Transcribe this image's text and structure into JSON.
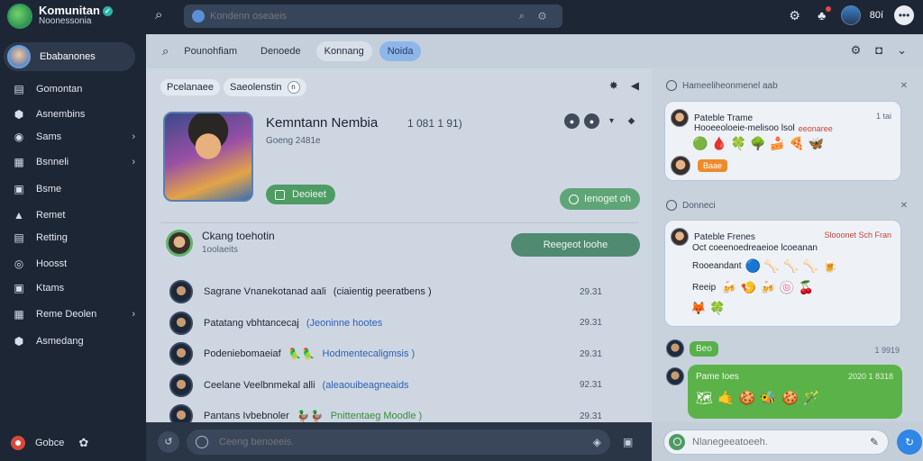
{
  "app": {
    "title": "Komunitan",
    "subtitle": "Noonessonia"
  },
  "top": {
    "search_placeholder": "Kondenn oseaeis",
    "search_tools": "⌕ ⚙",
    "count": "80í",
    "icons": [
      "gear-icon",
      "bell-icon",
      "avatar",
      "more-icon"
    ]
  },
  "sidebar": {
    "profile_name": "Ebabanones",
    "items": [
      {
        "label": "Gomontan",
        "icon": "▤",
        "chevron": ""
      },
      {
        "label": "Asnembins",
        "icon": "⬢",
        "chevron": ""
      },
      {
        "label": "Sams",
        "icon": "◉",
        "chevron": "›"
      },
      {
        "label": "Bsnneli",
        "icon": "▦",
        "chevron": "›"
      },
      {
        "label": "Bsme",
        "icon": "▣",
        "chevron": ""
      },
      {
        "label": "Remet",
        "icon": "▲",
        "chevron": ""
      },
      {
        "label": "Retting",
        "icon": "▤",
        "chevron": ""
      },
      {
        "label": "Hoosst",
        "icon": "◎",
        "chevron": ""
      },
      {
        "label": "Ktams",
        "icon": "▣",
        "chevron": ""
      },
      {
        "label": "Reme Deolen",
        "icon": "▦",
        "chevron": "›"
      },
      {
        "label": "Asmedang",
        "icon": "⬢",
        "chevron": ""
      }
    ],
    "bottom_label": "Gobce"
  },
  "tabs": {
    "items": [
      {
        "label": "Pounohfiam",
        "style": ""
      },
      {
        "label": "Denoede",
        "style": ""
      },
      {
        "label": "Konnang",
        "style": "pill"
      },
      {
        "label": "Noida",
        "style": "active"
      }
    ]
  },
  "main": {
    "header_left": "Pcelanaee",
    "header_right": "Saeolenstin",
    "header_chip": "n",
    "game": {
      "title": "Kemntann Nembia",
      "subtitle": "Goeng 2481e",
      "stat": "1 081 1 91)",
      "primary_button": "Deoieet",
      "secondary_button": "Ienoget oh"
    },
    "me": {
      "name": "Ckang toehotin",
      "sub": "1oolaeits"
    },
    "request_button": "Reegeot loohe",
    "rows": [
      {
        "name": "Sagrane Vnanekotanad aali",
        "emoji": "",
        "tag": "(ciaientig peeratbens )",
        "tag_style": "dark",
        "time": "29.31"
      },
      {
        "name": "Patatang vbhtancecaj",
        "emoji": "",
        "tag": "(Jeoninne hootes",
        "tag_style": "blue",
        "time": "29.31"
      },
      {
        "name": "Podeniebomaeiaf",
        "emoji": "🦜🦜",
        "tag": "Hodmentecaligmsis )",
        "tag_style": "blue",
        "time": "29.31"
      },
      {
        "name": "Ceelane Veelbnmekal alli",
        "emoji": "",
        "tag": "(aleaouibeagneaids",
        "tag_style": "blue",
        "time": "92.31"
      },
      {
        "name": "Pantans Ivbebnoler",
        "emoji": "🦆🦆",
        "tag": "Pnittentaeg Moodle )",
        "tag_style": "green",
        "time": "29.31"
      }
    ],
    "composer_placeholder": "Ceeng benoeeis."
  },
  "chat": {
    "section1": {
      "title": "Hameeliheonmenel aab",
      "action": "✕"
    },
    "card1": {
      "name": "Pateble Trame",
      "time": "1 tai",
      "line": "Hooeeoloeie-melisoo lsol",
      "red": "eeonaree",
      "emojis": "🟢🩸🍀🌳🍰🍕🦋",
      "chip": "Baae"
    },
    "section2": {
      "title": "Donneci",
      "action": "✕"
    },
    "card2": {
      "name": "Pateble Frenes",
      "meta": "Slooonet Sch Fran",
      "line1": "Oct coeenoedreaeioe lcoeanan",
      "line2_label": "Rooeandant",
      "line2_emojis": "🔵🦴🦴🦴🍺",
      "line3_label": "Reeip",
      "line3_emojis": "🍻🍤🍻🍥🍒",
      "line4_emojis": "🦊🍀"
    },
    "green_small": "Beo",
    "green_small_time": "1 9919",
    "green_card": {
      "name": "Pame Ioes",
      "time": "2020 1 8318",
      "emojis": "🗺🤙🍪🐝🍪🪄"
    },
    "composer_placeholder": "Nlanegeeatoeeh."
  }
}
